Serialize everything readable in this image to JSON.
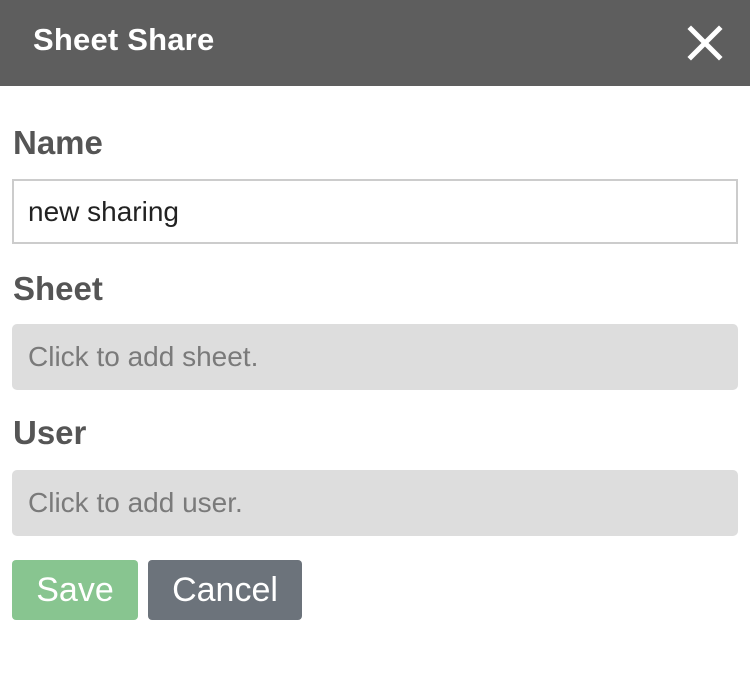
{
  "dialog": {
    "title": "Sheet Share",
    "close_icon": "close-icon"
  },
  "form": {
    "name_label": "Name",
    "name_value": "new sharing",
    "sheet_label": "Sheet",
    "sheet_placeholder": "Click to add sheet.",
    "user_label": "User",
    "user_placeholder": "Click to add user."
  },
  "buttons": {
    "save_label": "Save",
    "cancel_label": "Cancel"
  },
  "colors": {
    "header_bg": "#5e5e5e",
    "save_bg": "#88c590",
    "cancel_bg": "#6c737b",
    "picker_bg": "#dddddd"
  }
}
